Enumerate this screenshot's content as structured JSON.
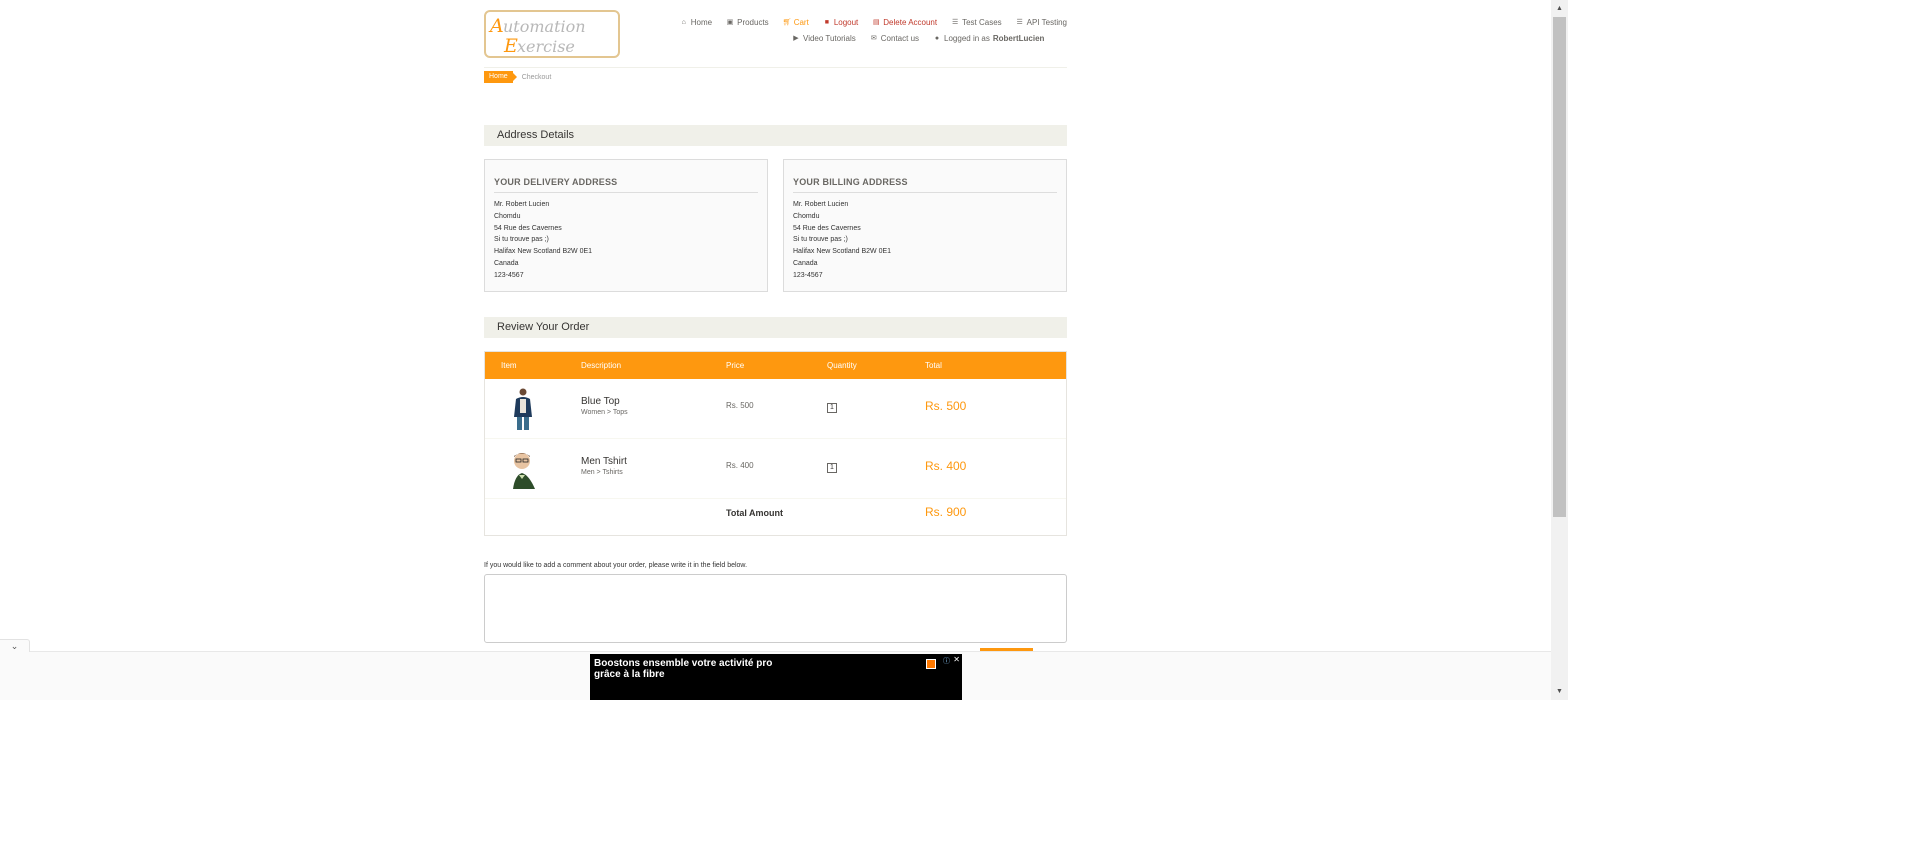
{
  "header": {
    "logo_text_1": "Automation",
    "logo_text_2": "Exercise",
    "nav_row1": [
      {
        "label": "Home",
        "icon": "home-icon"
      },
      {
        "label": "Products",
        "icon": "products-icon"
      },
      {
        "label": "Cart",
        "icon": "cart-icon"
      },
      {
        "label": "Logout",
        "icon": "lock-icon"
      },
      {
        "label": "Delete Account",
        "icon": "trash-icon"
      },
      {
        "label": "Test Cases",
        "icon": "list-icon"
      },
      {
        "label": "API Testing",
        "icon": "list-icon"
      }
    ],
    "nav_row2": [
      {
        "label": "Video Tutorials",
        "icon": "youtube-icon"
      },
      {
        "label": "Contact us",
        "icon": "envelope-icon"
      }
    ],
    "logged_in_prefix": "Logged in as",
    "logged_in_user": "RobertLucien"
  },
  "breadcrumb": {
    "home": "Home",
    "current": "Checkout"
  },
  "address_heading": "Address Details",
  "delivery": {
    "title": "YOUR DELIVERY ADDRESS",
    "lines": [
      "Mr. Robert Lucien",
      "Chomdu",
      "54 Rue des Cavernes",
      "Si tu trouve pas ;)",
      "Halifax New Scotland B2W 0E1",
      "Canada",
      "123-4567"
    ]
  },
  "billing": {
    "title": "YOUR BILLING ADDRESS",
    "lines": [
      "Mr. Robert Lucien",
      "Chomdu",
      "54 Rue des Cavernes",
      "Si tu trouve pas ;)",
      "Halifax New Scotland B2W 0E1",
      "Canada",
      "123-4567"
    ]
  },
  "review_heading": "Review Your Order",
  "table": {
    "headers": [
      "Item",
      "Description",
      "Price",
      "Quantity",
      "Total"
    ],
    "rows": [
      {
        "name": "Blue Top",
        "category": "Women > Tops",
        "price": "Rs. 500",
        "quantity": "1",
        "total": "Rs. 500"
      },
      {
        "name": "Men Tshirt",
        "category": "Men > Tshirts",
        "price": "Rs. 400",
        "quantity": "1",
        "total": "Rs. 400"
      }
    ],
    "total_label": "Total Amount",
    "total_value": "Rs. 900"
  },
  "comment_label": "If you would like to add a comment about your order, please write it in the field below.",
  "comment_value": "",
  "ad": {
    "text_line1": "Boostons ensemble votre activité pro",
    "text_line2": "grâce à la fibre",
    "info": "ⓘ",
    "close": "✕"
  },
  "colors": {
    "accent": "#fe980f",
    "heading_bg": "#f0f0e9",
    "danger": "#c0392b"
  }
}
